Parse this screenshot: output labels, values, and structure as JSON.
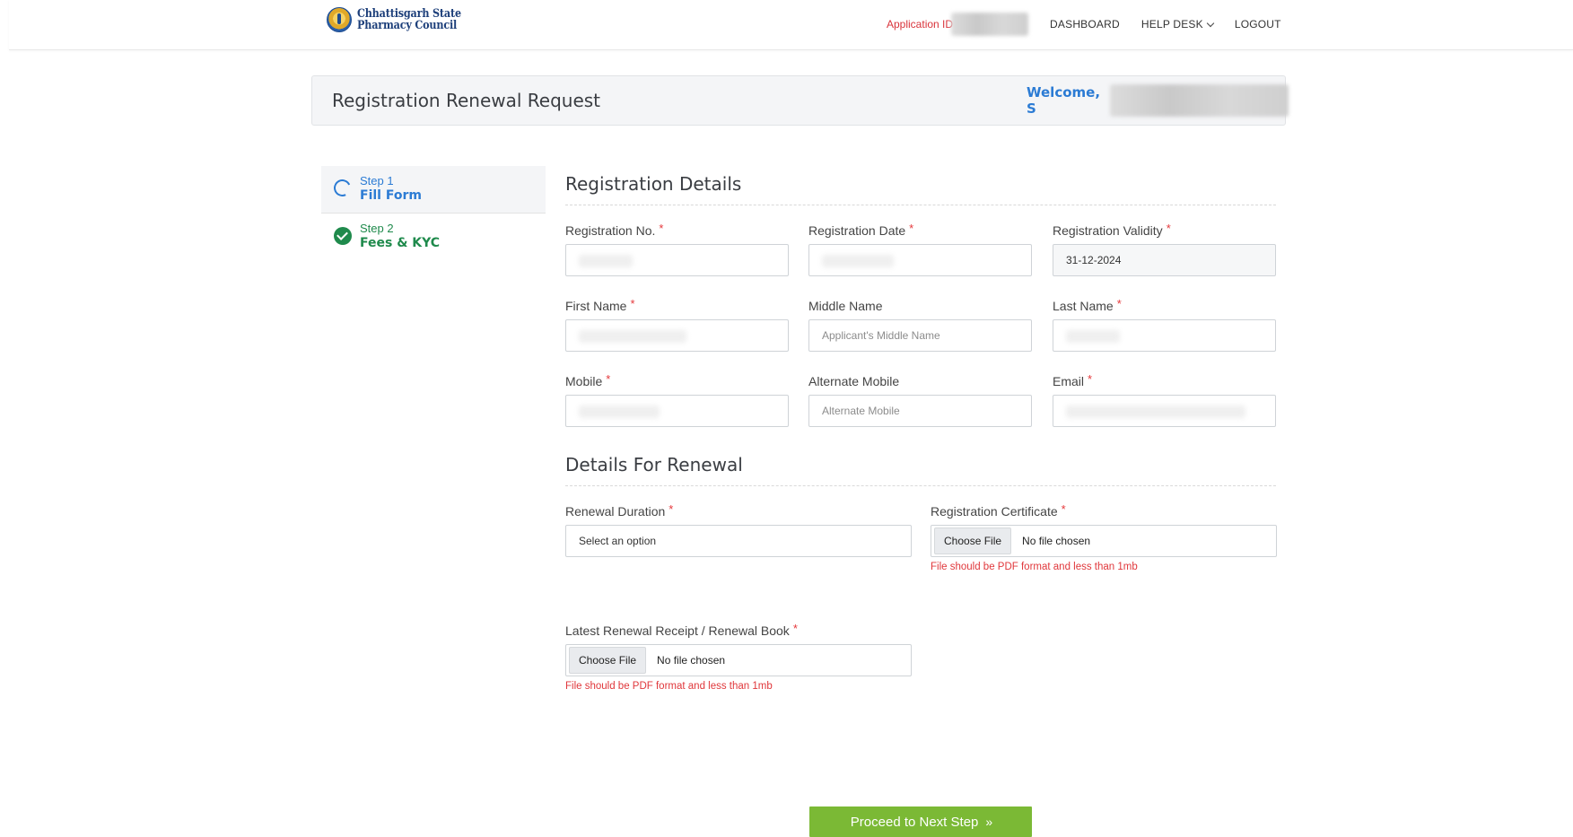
{
  "brand": {
    "name_line1": "Chhattisgarh State",
    "name_line2": "Pharmacy Council"
  },
  "nav": {
    "application_id_label": "Application ID",
    "dashboard": "DASHBOARD",
    "help_desk": "HELP DESK",
    "logout": "LOGOUT"
  },
  "header": {
    "title": "Registration Renewal Request",
    "welcome": "Welcome, S"
  },
  "steps": [
    {
      "num": "Step 1",
      "name": "Fill Form"
    },
    {
      "num": "Step 2",
      "name": "Fees & KYC"
    }
  ],
  "registration_details": {
    "title": "Registration Details",
    "registration_no": {
      "label": "Registration No.",
      "value": ""
    },
    "registration_date": {
      "label": "Registration Date",
      "value": ""
    },
    "registration_validity": {
      "label": "Registration Validity",
      "value": "31-12-2024"
    },
    "first_name": {
      "label": "First Name",
      "value": ""
    },
    "middle_name": {
      "label": "Middle Name",
      "placeholder": "Applicant's Middle Name"
    },
    "last_name": {
      "label": "Last Name",
      "value": ""
    },
    "mobile": {
      "label": "Mobile",
      "value": ""
    },
    "alternate_mobile": {
      "label": "Alternate Mobile",
      "placeholder": "Alternate Mobile"
    },
    "email": {
      "label": "Email",
      "value": ""
    }
  },
  "renewal_details": {
    "title": "Details For Renewal",
    "renewal_duration": {
      "label": "Renewal Duration",
      "value": "Select an option"
    },
    "registration_certificate": {
      "label": "Registration Certificate",
      "button": "Choose File",
      "status": "No file chosen",
      "hint": "File should be PDF format and less than 1mb"
    },
    "renewal_receipt": {
      "label": "Latest Renewal Receipt / Renewal Book",
      "button": "Choose File",
      "status": "No file chosen",
      "hint": "File should be PDF format and less than 1mb"
    }
  },
  "actions": {
    "proceed": "Proceed to Next Step",
    "proceed_arrows": "»"
  },
  "required_mark": "*",
  "colors": {
    "accent_blue": "#2b7bd4",
    "success_green": "#1f8a4c",
    "error_red": "#e0373b",
    "button_green": "#7bb935"
  }
}
